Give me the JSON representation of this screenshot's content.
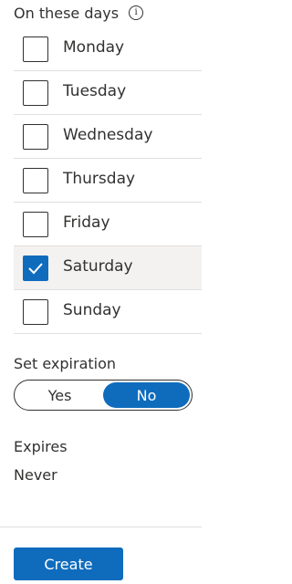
{
  "days_section": {
    "title": "On these days",
    "info_icon": "info-icon",
    "days": [
      {
        "label": "Monday",
        "checked": false
      },
      {
        "label": "Tuesday",
        "checked": false
      },
      {
        "label": "Wednesday",
        "checked": false
      },
      {
        "label": "Thursday",
        "checked": false
      },
      {
        "label": "Friday",
        "checked": false
      },
      {
        "label": "Saturday",
        "checked": true
      },
      {
        "label": "Sunday",
        "checked": false
      }
    ]
  },
  "expiration": {
    "label": "Set expiration",
    "options": [
      "Yes",
      "No"
    ],
    "selected": "No"
  },
  "expires": {
    "label": "Expires",
    "value": "Never"
  },
  "actions": {
    "create_label": "Create"
  },
  "colors": {
    "accent": "#0f6cbd",
    "selected_row": "#f3f2f1"
  }
}
